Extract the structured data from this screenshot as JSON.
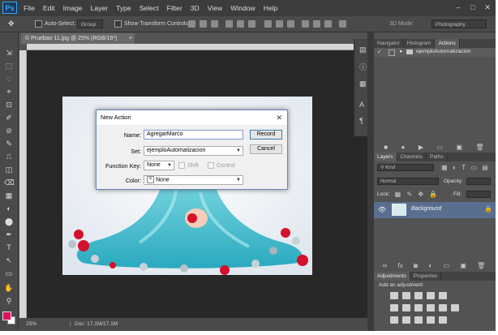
{
  "app": {
    "logo": "Ps"
  },
  "menu": [
    "File",
    "Edit",
    "Image",
    "Layer",
    "Type",
    "Select",
    "Filter",
    "3D",
    "View",
    "Window",
    "Help"
  ],
  "window_controls": [
    "–",
    "□",
    "✕"
  ],
  "options_bar": {
    "auto_select": "Auto-Select:",
    "group": "Group",
    "show_transform": "Show Transform Controls",
    "mode_3d": "3D Mode:",
    "workspace": "Photography"
  },
  "tools": [
    "⇲",
    "⬚",
    "◌",
    "⌖",
    "⊡",
    "✐",
    "⊘",
    "✎",
    "⎍",
    "◫",
    "⌫",
    "▦",
    "◐",
    "⬤",
    "✒",
    "T",
    "↖",
    "▭",
    "✋",
    "⚲"
  ],
  "document": {
    "tab_title": "© Pruebas-11.jpg @ 25% (RGB/16*)",
    "zoom": "25%",
    "doc_info": "Doc: 17,1M/17,1M"
  },
  "panels": {
    "top_tabs": [
      "Navigator",
      "Histogram",
      "Actions"
    ],
    "action_set": "ejemploAutomatizacion",
    "layer_tabs": [
      "Layers",
      "Channels",
      "Paths"
    ],
    "kind": "Kind",
    "blend_mode": "Normal",
    "opacity_label": "Opacity:",
    "lock_label": "Lock:",
    "fill_label": "Fill:",
    "layer_name": "Background",
    "adj_tabs": [
      "Adjustments",
      "Properties"
    ],
    "adj_title": "Add an adjustment"
  },
  "dialog": {
    "title": "New Action",
    "name_label": "Name:",
    "name_value": "AgregarMarco",
    "set_label": "Set:",
    "set_value": "ejemploAutomatizacion",
    "fkey_label": "Function Key:",
    "fkey_value": "None",
    "shift_label": "Shift",
    "control_label": "Control",
    "color_label": "Color:",
    "color_value": "None",
    "record_label": "Record",
    "cancel_label": "Cancel"
  },
  "colors": {
    "foreground": "#e0105c",
    "background": "#ffffff",
    "accent": "#31a8ff"
  }
}
